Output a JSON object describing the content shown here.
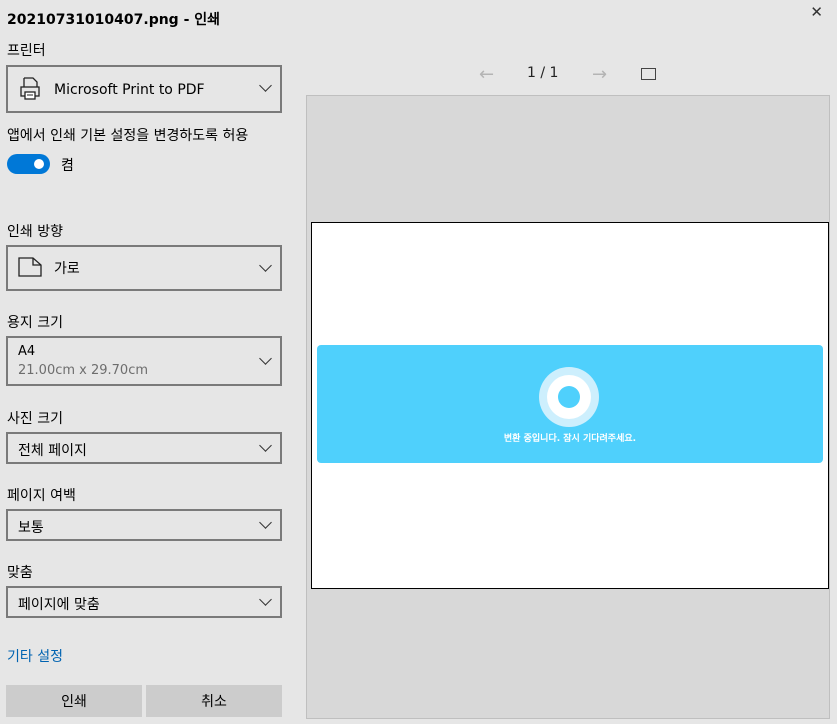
{
  "window": {
    "title": "20210731010407.png - 인쇄",
    "close_glyph": "✕"
  },
  "printer": {
    "label": "프린터",
    "value": "Microsoft Print to PDF"
  },
  "app_prefs": {
    "label": "앱에서 인쇄 기본 설정을 변경하도록 허용",
    "toggle_state": "켬"
  },
  "orientation": {
    "label": "인쇄 방향",
    "value": "가로"
  },
  "paper_size": {
    "label": "용지 크기",
    "value": "A4",
    "detail": "21.00cm x 29.70cm"
  },
  "photo_size": {
    "label": "사진 크기",
    "value": "전체 페이지"
  },
  "margins": {
    "label": "페이지 여백",
    "value": "보통"
  },
  "fit": {
    "label": "맞춤",
    "value": "페이지에 맞춤"
  },
  "more_settings": "기타 설정",
  "buttons": {
    "print": "인쇄",
    "cancel": "취소"
  },
  "preview": {
    "page_indicator": "1 / 1",
    "prev_glyph": "←",
    "next_glyph": "→",
    "banner_text": "변환 중입니다. 잠시 기다려주세요.",
    "banner_color": "#4fd0fc"
  }
}
